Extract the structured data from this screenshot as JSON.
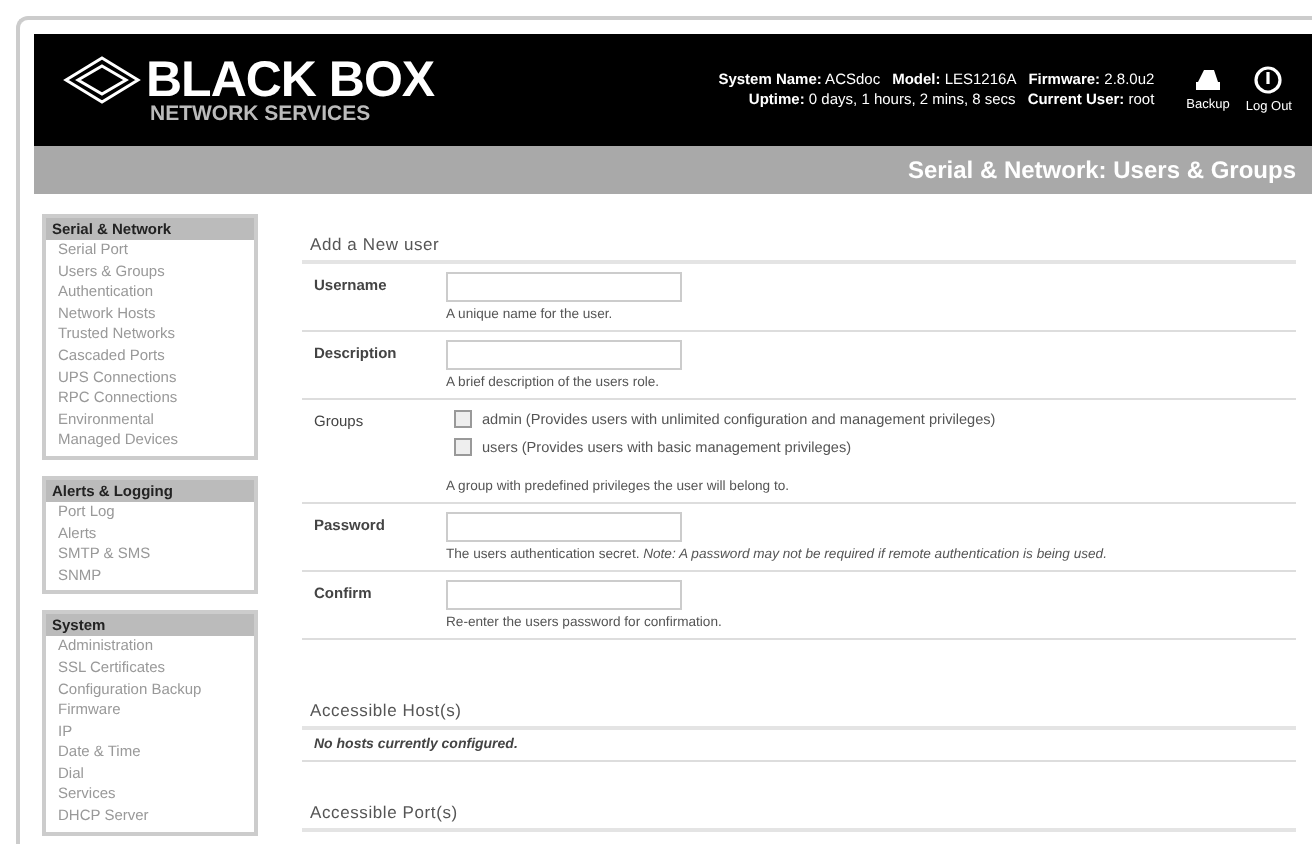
{
  "brand": {
    "name": "BLACK BOX",
    "tagline": "NETWORK SERVICES"
  },
  "system_info": [
    [
      {
        "label": "System Name:",
        "value": "ACSdoc"
      },
      {
        "label": "Model:",
        "value": "LES1216A"
      },
      {
        "label": "Firmware:",
        "value": "2.8.0u2"
      }
    ],
    [
      {
        "label": "Uptime:",
        "value": "0 days, 1 hours, 2 mins, 8 secs"
      },
      {
        "label": "Current User:",
        "value": "root"
      }
    ]
  ],
  "header_actions": [
    {
      "label": "Backup",
      "kind": "backup"
    },
    {
      "label": "Log Out",
      "kind": "logout"
    }
  ],
  "page_title": "Serial & Network: Users & Groups",
  "sidebar": [
    {
      "title": "Serial & Network",
      "items": [
        "Serial Port",
        "Users & Groups",
        "Authentication",
        "Network Hosts",
        "Trusted Networks",
        "Cascaded Ports",
        "UPS Connections",
        "RPC Connections",
        "Environmental",
        "Managed Devices"
      ]
    },
    {
      "title": "Alerts & Logging",
      "items": [
        "Port Log",
        "Alerts",
        "SMTP & SMS",
        "SNMP"
      ]
    },
    {
      "title": "System",
      "items": [
        "Administration",
        "SSL Certificates",
        "Configuration Backup",
        "Firmware",
        "IP",
        "Date & Time",
        "Dial",
        "Services",
        "DHCP Server"
      ]
    }
  ],
  "form": {
    "title": "Add a New user",
    "rows": [
      {
        "kind": "text",
        "label": "Username",
        "help": "A unique name for the user."
      },
      {
        "kind": "text",
        "label": "Description",
        "help": "A brief description of the users role."
      },
      {
        "kind": "checks",
        "label": "Groups",
        "options": [
          {
            "label": "admin (Provides users with unlimited configuration and management privileges)",
            "checked": false
          },
          {
            "label": "users (Provides users with basic management privileges)",
            "checked": false
          }
        ],
        "help": "A group with predefined privileges the user will belong to."
      },
      {
        "kind": "text",
        "label": "Password",
        "help": "The users authentication secret. *Note: A password may not be required if remote authentication is being used.*"
      },
      {
        "kind": "text",
        "label": "Confirm",
        "help": "Re-enter the users password for confirmation."
      }
    ]
  },
  "hosts": {
    "title": "Accessible Host(s)",
    "empty": "No hosts currently configured."
  },
  "ports": {
    "title": "Accessible Port(s)"
  }
}
